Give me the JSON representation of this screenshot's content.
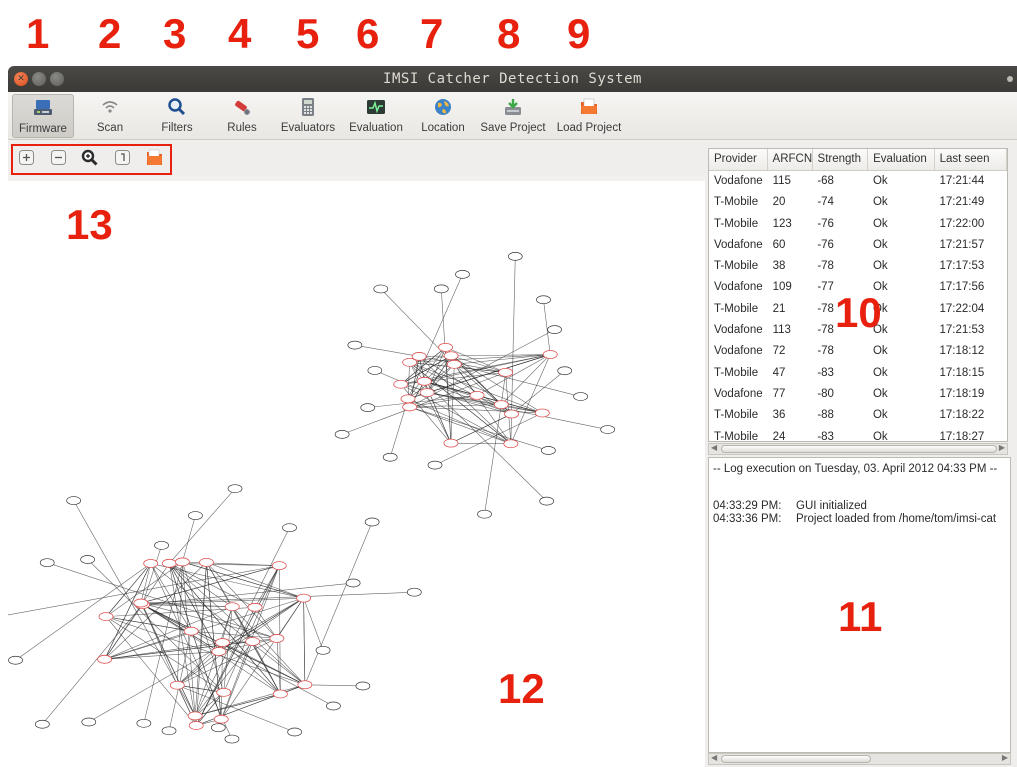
{
  "callouts": [
    "1",
    "2",
    "3",
    "4",
    "5",
    "6",
    "7",
    "8",
    "9",
    "10",
    "11",
    "12",
    "13"
  ],
  "window": {
    "title": "IMSI Catcher Detection System"
  },
  "toolbar": {
    "items": [
      {
        "label": "Firmware",
        "icon": "firmware-icon",
        "active": true
      },
      {
        "label": "Scan",
        "icon": "wifi-scan-icon"
      },
      {
        "label": "Filters",
        "icon": "magnifier-icon"
      },
      {
        "label": "Rules",
        "icon": "wrench-rules-icon"
      },
      {
        "label": "Evaluators",
        "icon": "calculator-icon"
      },
      {
        "label": "Evaluation",
        "icon": "heartbeat-monitor-icon"
      },
      {
        "label": "Location",
        "icon": "globe-icon"
      },
      {
        "label": "Save Project",
        "icon": "save-drive-icon"
      },
      {
        "label": "Load Project",
        "icon": "folder-open-icon"
      }
    ]
  },
  "graph_tools": [
    {
      "icon": "zoom-in-box-icon"
    },
    {
      "icon": "zoom-out-box-icon"
    },
    {
      "icon": "zoom-magnifier-icon"
    },
    {
      "icon": "zoom-reset-box-icon"
    },
    {
      "icon": "folder-icon"
    }
  ],
  "table": {
    "columns": [
      "Provider",
      "ARFCN",
      "Strength",
      "Evaluation",
      "Last seen"
    ],
    "rows": [
      [
        "Vodafone",
        "115",
        "-68",
        "Ok",
        "17:21:44"
      ],
      [
        "T-Mobile",
        "20",
        "-74",
        "Ok",
        "17:21:49"
      ],
      [
        "T-Mobile",
        "123",
        "-76",
        "Ok",
        "17:22:00"
      ],
      [
        "Vodafone",
        "60",
        "-76",
        "Ok",
        "17:21:57"
      ],
      [
        "T-Mobile",
        "38",
        "-78",
        "Ok",
        "17:17:53"
      ],
      [
        "Vodafone",
        "109",
        "-77",
        "Ok",
        "17:17:56"
      ],
      [
        "T-Mobile",
        "21",
        "-78",
        "Ok",
        "17:22:04"
      ],
      [
        "Vodafone",
        "113",
        "-78",
        "Ok",
        "17:21:53"
      ],
      [
        "Vodafone",
        "72",
        "-78",
        "Ok",
        "17:18:12"
      ],
      [
        "T-Mobile",
        "47",
        "-83",
        "Ok",
        "17:18:15"
      ],
      [
        "Vodafone",
        "77",
        "-80",
        "Ok",
        "17:18:19"
      ],
      [
        "T-Mobile",
        "36",
        "-88",
        "Ok",
        "17:18:22"
      ],
      [
        "T-Mobile",
        "24",
        "-83",
        "Ok",
        "17:18:27"
      ]
    ]
  },
  "log": {
    "header": "-- Log execution on Tuesday, 03. April 2012 04:33 PM  --",
    "entries": [
      {
        "time": "04:33:29 PM:",
        "message": "GUI initialized"
      },
      {
        "time": "04:33:36 PM:",
        "message": "Project loaded from  /home/tom/imsi-cat"
      }
    ]
  },
  "colors": {
    "callout": "#e8210f",
    "node_highlight": "#e05050",
    "titlebar": "#3b3a37"
  }
}
